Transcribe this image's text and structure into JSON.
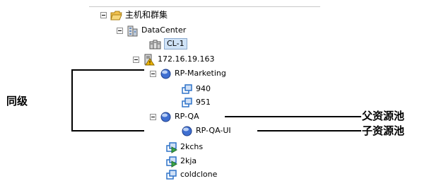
{
  "tree": {
    "root": "主机和群集",
    "datacenter": "DataCenter",
    "cluster": "CL-1",
    "host": "172.16.19.163",
    "pool1": "RP-Marketing",
    "vm_940": "940",
    "vm_951": "951",
    "pool2": "RP-QA",
    "child_pool": "RP-QA-UI",
    "vm_2kchs": "2kchs",
    "vm_2kja": "2kja",
    "vm_coldclone": "coldclone"
  },
  "annotations": {
    "sibling": "同级",
    "parent_pool": "父资源池",
    "child_pool": "子资源池"
  },
  "colors": {
    "selection": "#d0e3f7",
    "folder": "#f2c14e",
    "pool": "#3f6fd1",
    "vm": "#2f73c9",
    "vm_running": "#3aa64a",
    "warning": "#f0b400"
  }
}
